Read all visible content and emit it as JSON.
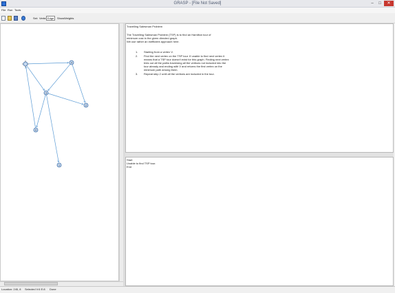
{
  "window": {
    "title": "GRASP - [File Not Saved]"
  },
  "menu": [
    "File",
    "Run",
    "Tools"
  ],
  "toolbar": {
    "set_label": "Set:",
    "vertex_label": "Vertex",
    "edge_label": "Edge",
    "weights_label": "ShowWeights"
  },
  "description": {
    "title": "Travelling Salesman Problem",
    "intro": [
      "The Travelling Salesman Problem (TSP) is to find an Hamilton tour of",
      "minimum cost in the given directed graph.",
      "We use rather an inefficient approach here."
    ],
    "steps": [
      {
        "num": "1.",
        "lines": [
          "Starting from a vertex V."
        ]
      },
      {
        "num": "2.",
        "lines": [
          "Find the next vertex on the TSP tour. If unable to find next vertex it",
          "means that a TSP tour doesn't exist for this graph. Finding next vertex",
          "tries out all the paths traversing all the vertices not included into the",
          "tour already and ending with V and returns the first vertex on the",
          "minimum path among them."
        ]
      },
      {
        "num": "3.",
        "lines": [
          "Repeat step 2 until all the vertices are included in the tour."
        ]
      }
    ]
  },
  "output": {
    "lines": [
      "Start",
      "Unable to find TSP tour.",
      "End"
    ]
  },
  "graph": {
    "vertices": [
      {
        "id": "start",
        "label": ""
      },
      {
        "id": "v4",
        "label": "4"
      },
      {
        "id": "v3",
        "label": "3"
      },
      {
        "id": "v2",
        "label": "2"
      },
      {
        "id": "v0",
        "label": "0"
      },
      {
        "id": "v1",
        "label": "1"
      }
    ],
    "edges": [
      [
        "start",
        "v4"
      ],
      [
        "v4",
        "v3"
      ],
      [
        "start",
        "v3"
      ],
      [
        "v3",
        "v2"
      ],
      [
        "v3",
        "v0"
      ],
      [
        "v0",
        "start"
      ],
      [
        "v3",
        "v1"
      ],
      [
        "v4",
        "v2"
      ]
    ]
  },
  "status": {
    "location": "Location: 245, 8",
    "selected": "Selected V:6 E:8",
    "state": "Done"
  },
  "colors": {
    "edge": "#5b9bd5",
    "vertex_fill": "#c6d9ef",
    "vertex_stroke": "#3f6fa8"
  }
}
